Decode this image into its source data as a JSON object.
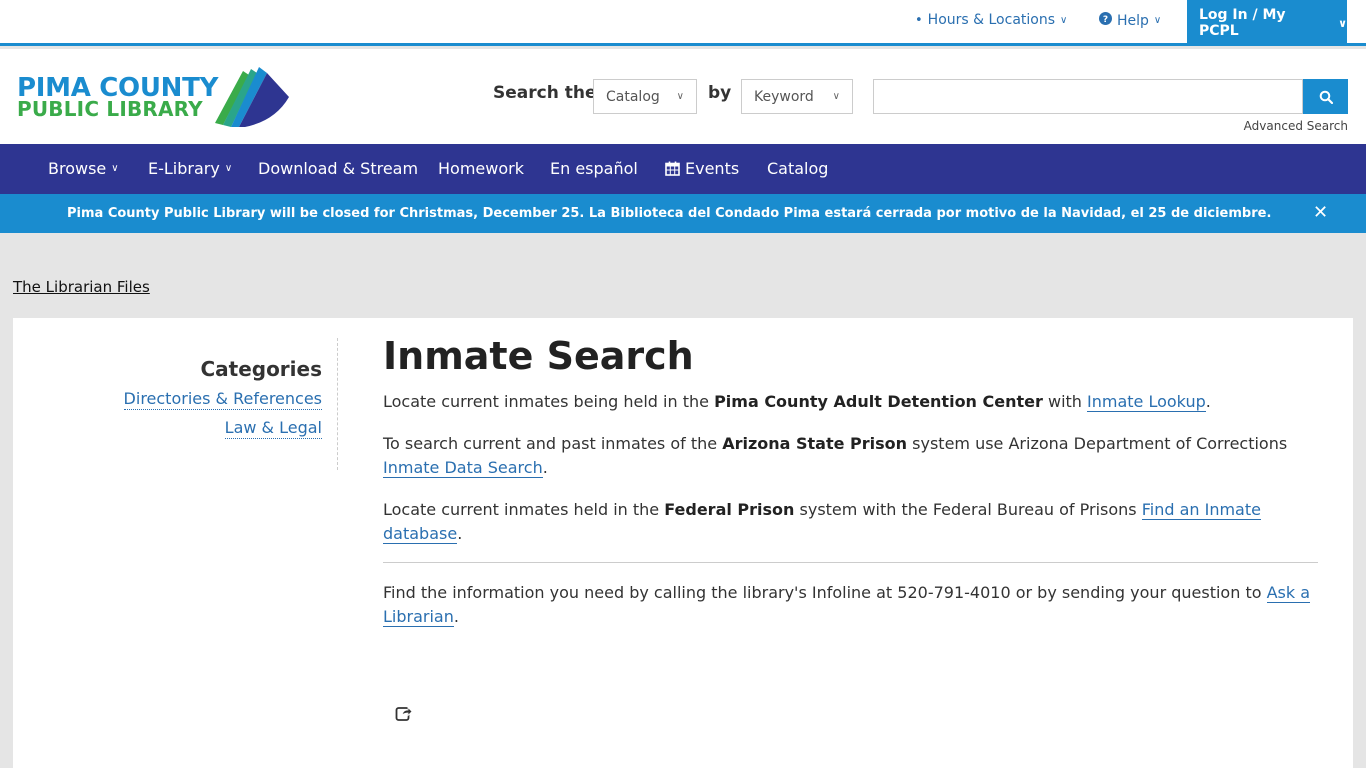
{
  "utility": {
    "hours": "Hours & Locations",
    "help": "Help",
    "login": "Log In / My PCPL"
  },
  "logo": {
    "line1": "PIMA COUNTY",
    "line2": "PUBLIC LIBRARY"
  },
  "search": {
    "label_prefix": "Search the",
    "scope": "Catalog",
    "by_label": "by",
    "type": "Keyword",
    "query": "",
    "advanced": "Advanced Search"
  },
  "nav": {
    "browse": "Browse",
    "elibrary": "E-Library",
    "download": "Download & Stream",
    "homework": "Homework",
    "espanol": "En español",
    "events": "Events",
    "catalog": "Catalog"
  },
  "alert": {
    "text": "Pima County Public Library will be closed for Christmas, December 25. La Biblioteca del Condado Pima estará cerrada por motivo de la Navidad, el 25 de diciembre.",
    "close": "✕"
  },
  "breadcrumb": "The Librarian Files",
  "sidebar": {
    "title": "Categories",
    "items": [
      "Directories & References",
      "Law & Legal"
    ]
  },
  "main": {
    "title": "Inmate Search",
    "p1": {
      "a": "Locate current inmates being held in the ",
      "b": "Pima County Adult Detention Center",
      "c": " with ",
      "link": "Inmate Lookup",
      "d": "."
    },
    "p2": {
      "a": "To search current and past inmates of the ",
      "b": "Arizona State Prison",
      "c": " system use Arizona Department of Corrections ",
      "link": "Inmate Data Search",
      "d": "."
    },
    "p3": {
      "a": "Locate current inmates held in the ",
      "b": "Federal Prison",
      "c": " system with the Federal Bureau of Prisons ",
      "link": "Find an Inmate database",
      "d": "."
    },
    "p4": {
      "a": "Find the information you need by calling the library's Infoline at 520-791-4010 or by sending your question to ",
      "link": "Ask a Librarian",
      "d": "."
    }
  },
  "colors": {
    "brand_blue": "#1a8ccf",
    "nav_indigo": "#2e3591",
    "logo_green": "#3aab4a",
    "link": "#2a6fb0"
  }
}
